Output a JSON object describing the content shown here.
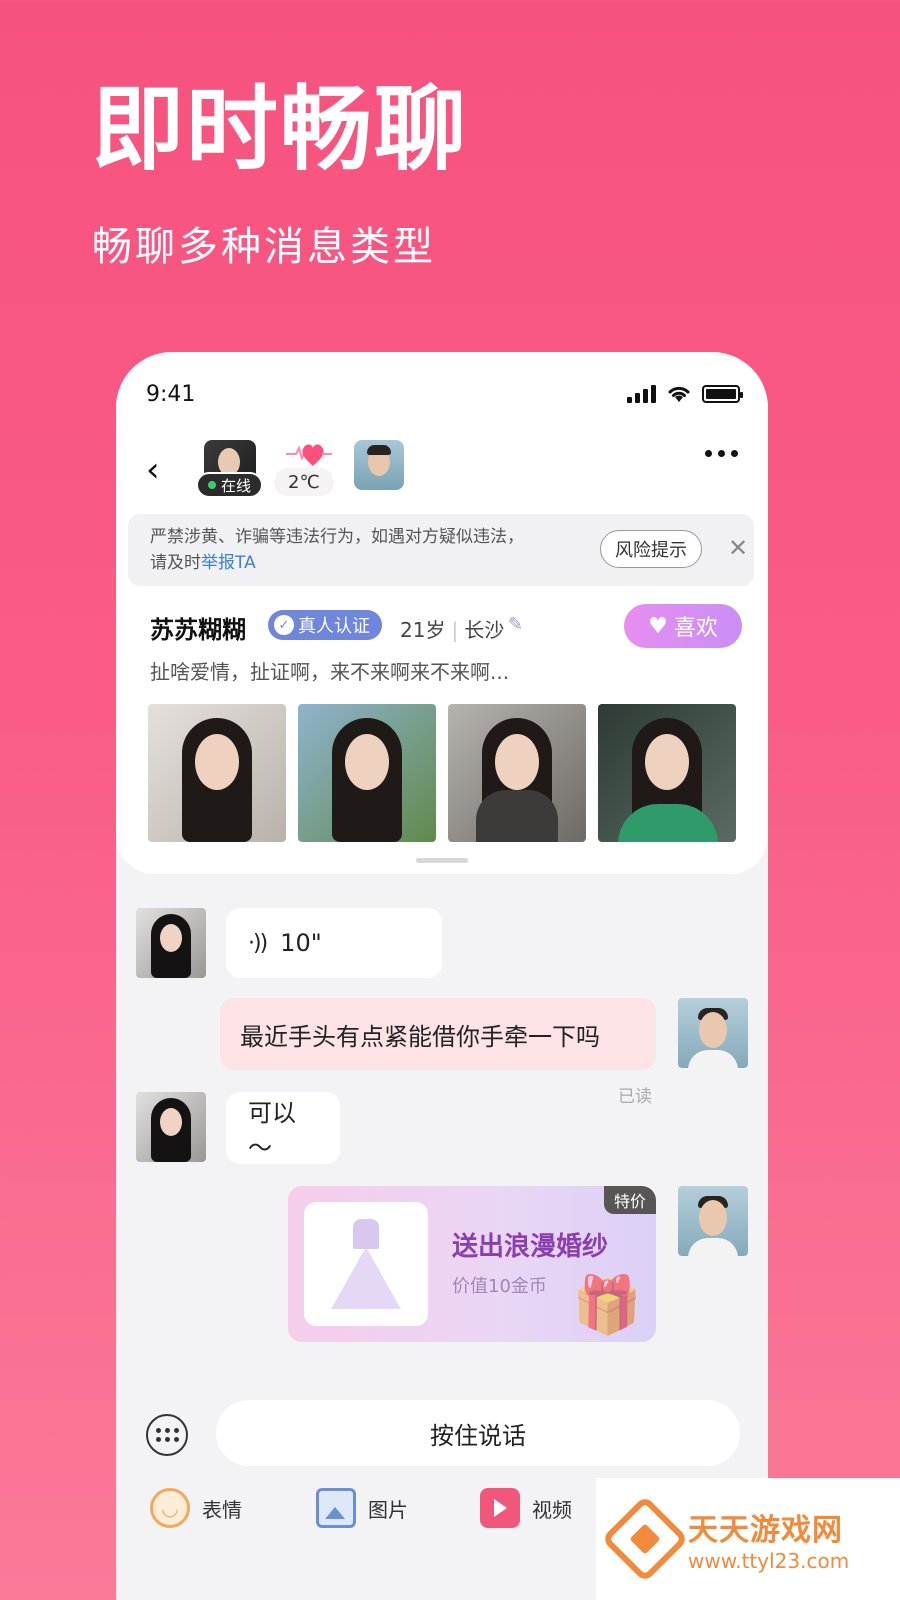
{
  "promo": {
    "title": "即时畅聊",
    "subtitle": "畅聊多种消息类型"
  },
  "status_bar": {
    "time": "9:41"
  },
  "chat_header": {
    "online_label": "在线",
    "temperature": "2℃"
  },
  "warning": {
    "text_line1": "严禁涉黄、诈骗等违法行为，如遇对方疑似违法，",
    "text_line2_prefix": "请及时",
    "report_link": "举报TA",
    "risk_button": "风险提示"
  },
  "profile": {
    "name": "苏苏糊糊",
    "verified_label": "真人认证",
    "age": "21岁",
    "city": "长沙",
    "like_label": "喜欢",
    "bio": "扯啥爱情，扯证啊，来不来啊来不来啊..."
  },
  "messages": [
    {
      "from": "her",
      "type": "voice",
      "duration": "10\""
    },
    {
      "from": "me",
      "type": "text",
      "text": "最近手头有点紧能借你手牵一下吗",
      "read_label": "已读"
    },
    {
      "from": "her",
      "type": "text",
      "text": "可以～"
    },
    {
      "from": "me",
      "type": "gift",
      "title": "送出浪漫婚纱",
      "value": "价值10金币",
      "tag": "特价"
    }
  ],
  "input": {
    "hold_to_talk": "按住说话"
  },
  "toolbar": {
    "emoji_label": "表情",
    "image_label": "图片",
    "video_label": "视频"
  },
  "watermark": {
    "name": "天天游戏网",
    "url": "www.ttyl23.com"
  },
  "colors": {
    "background": "#f7527f",
    "accent_blue": "#3b7fd8",
    "verified_badge": "#6f86dd",
    "outgoing_bubble": "#fde3e6",
    "gift_title": "#8a3fb0"
  }
}
